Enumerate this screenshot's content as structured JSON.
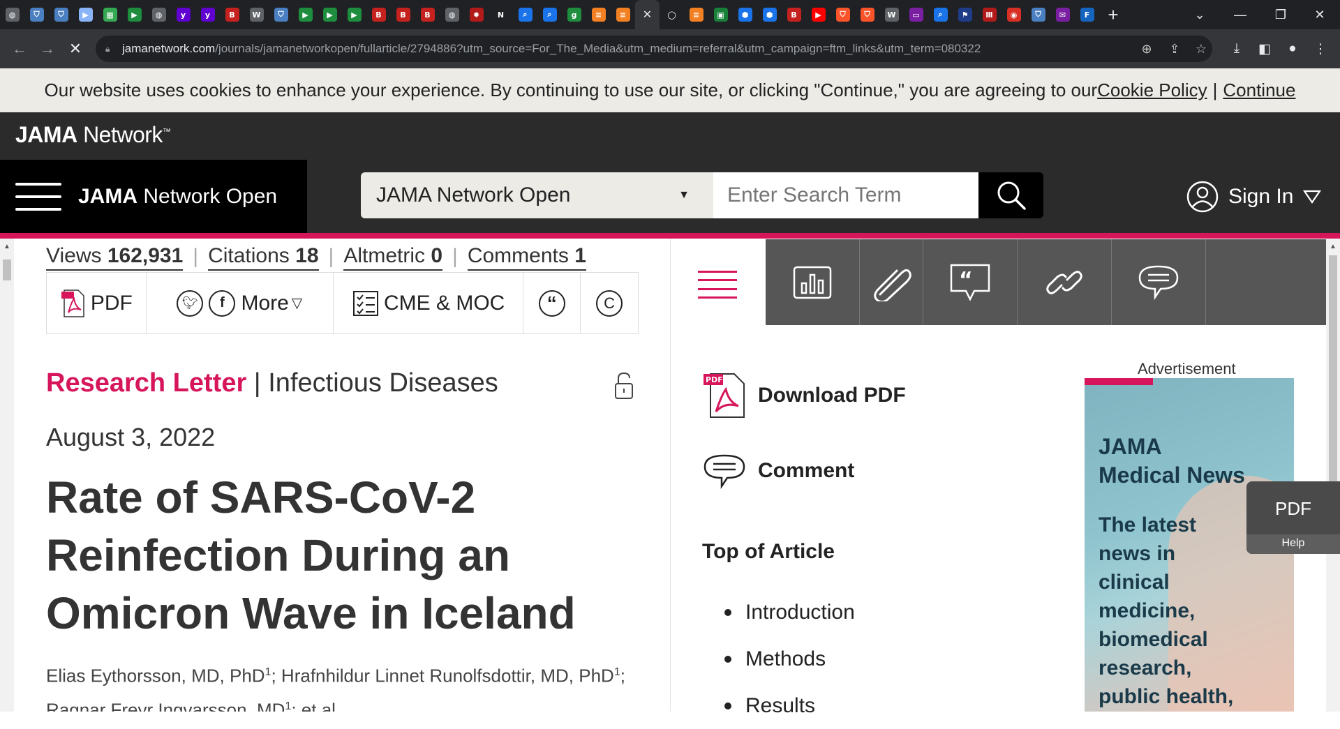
{
  "browser": {
    "url_domain": "jamanetwork.com",
    "url_path": "/journals/jamanetworkopen/fullarticle/2794886?utm_source=For_The_Media&utm_medium=referral&utm_campaign=ftm_links&utm_term=080322"
  },
  "cookie_banner": {
    "text": "Our website uses cookies to enhance your experience. By continuing to use our site, or clicking \"Continue,\" you are agreeing to our ",
    "policy_link": "Cookie Policy",
    "separator": "|",
    "continue_link": "Continue"
  },
  "brand": {
    "logo_bold": "JAMA",
    "logo_regular": " Network",
    "logo_tm": "™"
  },
  "nav": {
    "journal_bold": "JAMA",
    "journal_rest": " Network Open",
    "search_scope": "JAMA Network Open",
    "search_placeholder": "Enter Search Term",
    "sign_in": "Sign In"
  },
  "metrics": {
    "views_label": "Views",
    "views_value": "162,931",
    "citations_label": "Citations",
    "citations_value": "18",
    "altmetric_label": "Altmetric",
    "altmetric_value": "0",
    "comments_label": "Comments",
    "comments_value": "1",
    "separator": "|"
  },
  "actions": {
    "pdf": "PDF",
    "more": "More",
    "cme": "CME & MOC",
    "quote_glyph": "“",
    "copyright_glyph": "C"
  },
  "article": {
    "type": "Research Letter",
    "separator": " | ",
    "category": "Infectious Diseases",
    "date": "August 3, 2022",
    "title": "Rate of SARS-CoV-2 Reinfection During an Omicron Wave in Iceland",
    "authors": [
      {
        "name": "Elias Eythorsson, MD, PhD",
        "sup": "1",
        "after": "; "
      },
      {
        "name": "Hrafnhildur Linnet Runolfsdottir, MD, PhD",
        "sup": "1",
        "after": ";"
      },
      {
        "name": "Ragnar Freyr Ingvarsson, MD",
        "sup": "1",
        "after": "; et al"
      }
    ]
  },
  "sidebar": {
    "download_pdf": "Download PDF",
    "comment": "Comment",
    "top_of_article": "Top of Article",
    "toc": [
      "Introduction",
      "Methods",
      "Results"
    ]
  },
  "ad": {
    "label": "Advertisement",
    "title_line1": "JAMA",
    "title_line2": "Medical News",
    "body_lines": [
      "The latest",
      "news in",
      "clinical",
      "medicine,",
      "biomedical",
      "research,",
      "public health,"
    ]
  },
  "pdf_help": {
    "title": "PDF",
    "help": "Help"
  },
  "colors": {
    "accent": "#d6155b",
    "dark": "#2b2b2b",
    "cookie_bg": "#ecebe6"
  }
}
